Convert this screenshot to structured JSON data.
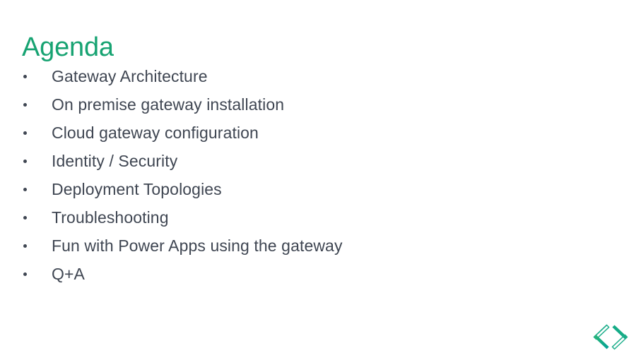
{
  "slide": {
    "title": "Agenda",
    "title_color": "#17A372",
    "body_color": "#3F4652",
    "background_color": "#FFFFFF",
    "items": [
      {
        "label": "Gateway Architecture"
      },
      {
        "label": "On premise gateway installation"
      },
      {
        "label": "Cloud gateway configuration"
      },
      {
        "label": "Identity / Security"
      },
      {
        "label": "Deployment Topologies"
      },
      {
        "label": "Troubleshooting"
      },
      {
        "label": "Fun with Power Apps using the gateway"
      },
      {
        "label": "Q+A"
      }
    ]
  },
  "logo": {
    "name": "angle-brackets-logo",
    "glyph": "<>",
    "color_dark": "#00A19A",
    "color_light": "#2BB673",
    "color_outline": "#1FAF8C"
  }
}
